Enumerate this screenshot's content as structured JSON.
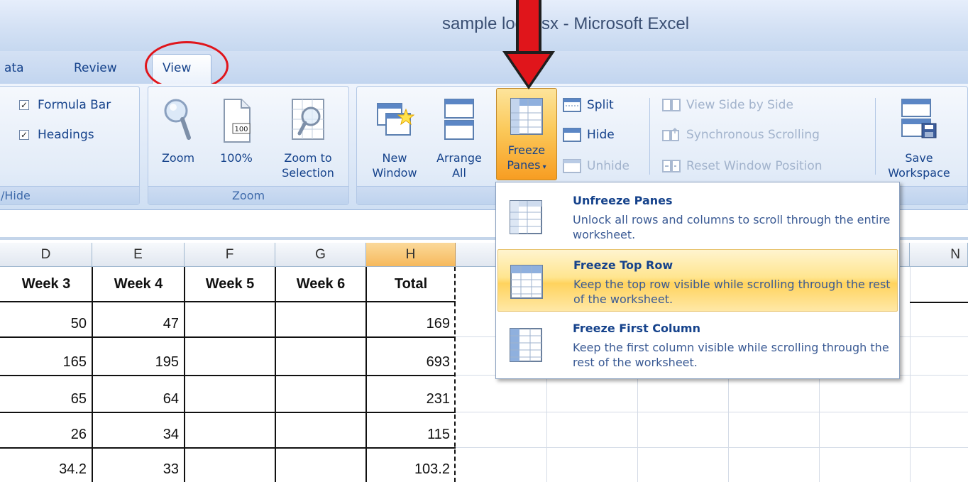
{
  "window": {
    "title": "sample log.xlsx - Microsoft Excel"
  },
  "tabs": [
    {
      "label": "ata"
    },
    {
      "label": "Review"
    },
    {
      "label": "View",
      "active": true
    }
  ],
  "ribbon": {
    "show_hide": {
      "label": "/Hide",
      "formula_bar": {
        "label": "Formula Bar",
        "checked": true
      },
      "headings": {
        "label": "Headings",
        "checked": true
      }
    },
    "zoom": {
      "label": "Zoom",
      "zoom_button": "Zoom",
      "zoom_100_button": "100%",
      "zoom_100_icon_text": "100",
      "zoom_selection_line1": "Zoom to",
      "zoom_selection_line2": "Selection"
    },
    "window": {
      "new_window_line1": "New",
      "new_window_line2": "Window",
      "arrange_all_line1": "Arrange",
      "arrange_all_line2": "All",
      "freeze_panes_line1": "Freeze",
      "freeze_panes_line2": "Panes",
      "split": "Split",
      "hide": "Hide",
      "unhide": "Unhide",
      "view_side_by_side": "View Side by Side",
      "synchronous_scrolling": "Synchronous Scrolling",
      "reset_window_position": "Reset Window Position",
      "save_workspace_line1": "Save",
      "save_workspace_line2": "Workspace"
    }
  },
  "freeze_menu": {
    "items": [
      {
        "title": "Unfreeze Panes",
        "description": "Unlock all rows and columns to scroll through the entire worksheet."
      },
      {
        "title": "Freeze Top Row",
        "description": "Keep the top row visible while scrolling through the rest of the worksheet.",
        "highlighted": true
      },
      {
        "title": "Freeze First Column",
        "description": "Keep the first column visible while scrolling through the rest of the worksheet."
      }
    ]
  },
  "sheet": {
    "columns": [
      "D",
      "E",
      "F",
      "G",
      "H",
      "N"
    ],
    "selected_column": "H",
    "header_row": [
      "Week 3",
      "Week 4",
      "Week 5",
      "Week 6",
      "Total"
    ],
    "rows": [
      [
        "50",
        "47",
        "",
        "",
        "169"
      ],
      [
        "165",
        "195",
        "",
        "",
        "693"
      ],
      [
        "65",
        "64",
        "",
        "",
        "231"
      ],
      [
        "26",
        "34",
        "",
        "",
        "115"
      ],
      [
        "34.2",
        "33",
        "",
        "",
        "103.2"
      ]
    ]
  },
  "colors": {
    "accent_orange": "#f79d22",
    "annotation_red": "#e0151b",
    "ribbon_text": "#15428b"
  }
}
